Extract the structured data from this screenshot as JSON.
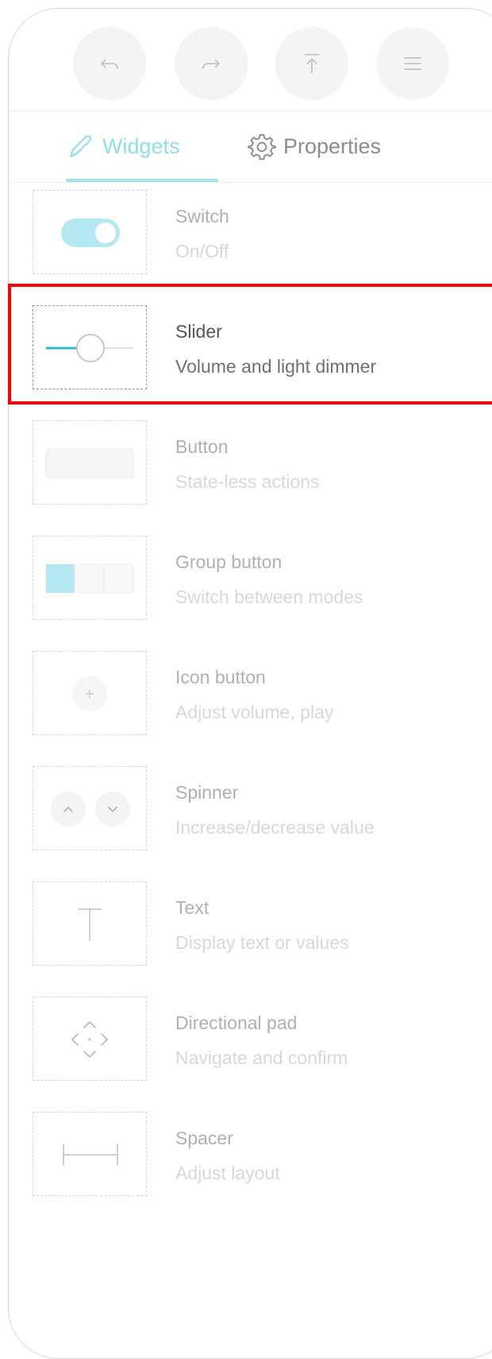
{
  "toolbar": {
    "buttons": [
      {
        "icon": "undo-icon"
      },
      {
        "icon": "redo-icon"
      },
      {
        "icon": "upload-icon"
      },
      {
        "icon": "menu-icon"
      }
    ]
  },
  "tabs": {
    "widgets_label": "Widgets",
    "properties_label": "Properties",
    "active": "Widgets",
    "accent_color": "#8fdde9"
  },
  "widgets": [
    {
      "title": "Switch",
      "subtitle": "On/Off",
      "icon": "toggle-switch-icon"
    },
    {
      "title": "Slider",
      "subtitle": "Volume and light dimmer",
      "icon": "slider-icon",
      "selected": true
    },
    {
      "title": "Button",
      "subtitle": "State-less actions",
      "icon": "button-icon"
    },
    {
      "title": "Group button",
      "subtitle": "Switch between modes",
      "icon": "group-button-icon"
    },
    {
      "title": "Icon button",
      "subtitle": "Adjust volume, play",
      "icon": "plus-icon"
    },
    {
      "title": "Spinner",
      "subtitle": "Increase/decrease value",
      "icon": "spinner-icon"
    },
    {
      "title": "Text",
      "subtitle": "Display text or values",
      "icon": "text-icon"
    },
    {
      "title": "Directional pad",
      "subtitle": "Navigate and confirm",
      "icon": "directional-pad-icon"
    },
    {
      "title": "Spacer",
      "subtitle": "Adjust layout",
      "icon": "spacer-icon"
    }
  ]
}
